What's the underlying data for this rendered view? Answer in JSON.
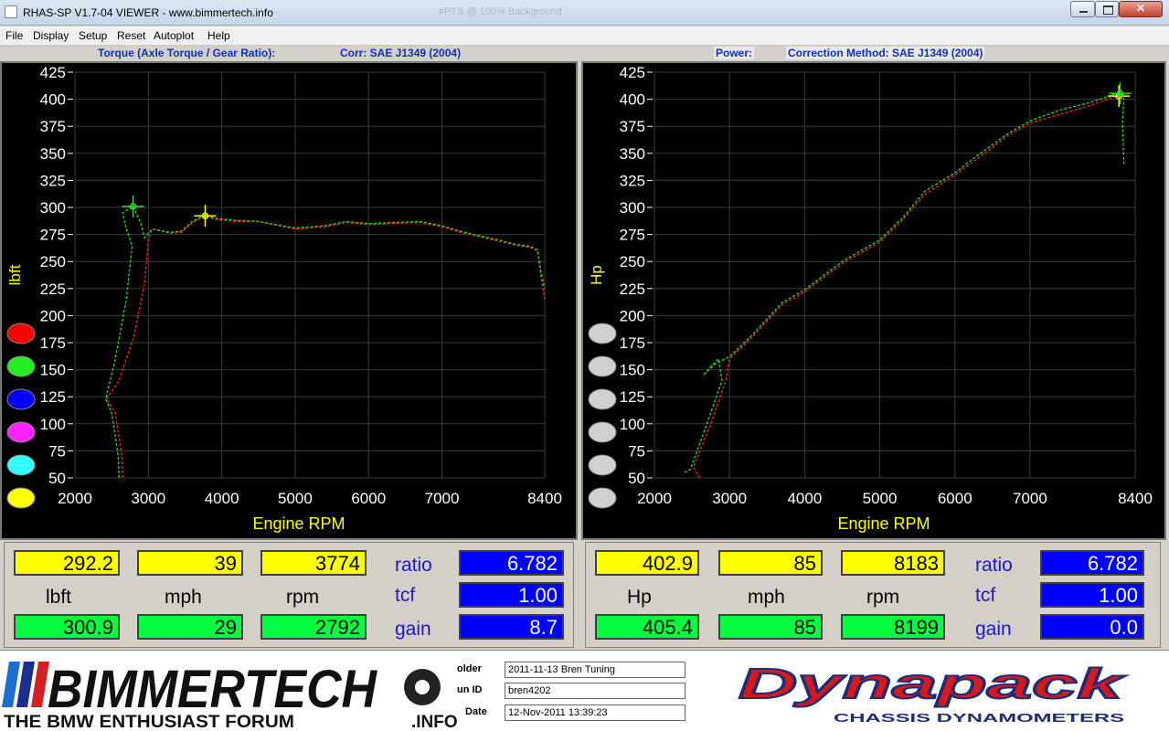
{
  "window": {
    "title": "RHAS-SP V1.7-04  VIEWER - www.bimmertech.info",
    "ghost_title": "#PTS @ 100% Background"
  },
  "menu": [
    "File",
    "Display",
    "Setup",
    "Reset",
    "Autoplot",
    "Help"
  ],
  "left_chart": {
    "header_title": "Torque (Axle Torque / Gear Ratio):",
    "header_corr": "Corr: SAE J1349 (2004)"
  },
  "right_chart": {
    "header_title": "Power:",
    "header_corr": "Correction Method: SAE J1349 (2004)"
  },
  "chart_data": [
    {
      "type": "line",
      "title": "Torque (Axle Torque / Gear Ratio):",
      "xlabel": "Engine RPM",
      "ylabel": "lbft",
      "xlim": [
        2000,
        8400
      ],
      "ylim": [
        50,
        425
      ],
      "x_ticks": [
        "2000",
        "3000",
        "4000",
        "5000",
        "6000",
        "7000",
        "8400"
      ],
      "x_tick_values": [
        2000,
        3000,
        4000,
        5000,
        6000,
        7000,
        8400
      ],
      "y_ticks": [
        50,
        75,
        100,
        125,
        150,
        175,
        200,
        225,
        250,
        275,
        300,
        325,
        350,
        375,
        400,
        425
      ],
      "grid": true,
      "series": [
        {
          "color": "#ff2020",
          "x": [
            2650,
            2640,
            2550,
            2430,
            2600,
            2800,
            2950,
            3000,
            3050,
            3300,
            3450,
            3600,
            3774,
            3900,
            4200,
            4500,
            5000,
            5400,
            5700,
            6000,
            6300,
            6700,
            7000,
            7300,
            7700,
            8000,
            8200,
            8300,
            8350,
            8400
          ],
          "y": [
            50,
            70,
            110,
            123,
            140,
            180,
            230,
            270,
            280,
            276,
            277,
            286,
            292,
            289,
            287,
            287,
            280,
            282,
            286,
            284,
            285,
            286,
            282,
            276,
            270,
            265,
            263,
            260,
            235,
            215
          ]
        },
        {
          "color": "#20e020",
          "x": [
            2600,
            2590,
            2500,
            2420,
            2550,
            2700,
            2780,
            2700,
            2650,
            2792,
            2900,
            2950,
            3050,
            3300,
            3450,
            3600,
            3774,
            3900,
            4200,
            4500,
            5000,
            5400,
            5700,
            6000,
            6300,
            6700,
            7000,
            7300,
            7700,
            8000,
            8200,
            8300,
            8350,
            8400
          ],
          "y": [
            50,
            70,
            110,
            123,
            160,
            215,
            265,
            280,
            295,
            301,
            285,
            272,
            280,
            277,
            278,
            287,
            293,
            290,
            288,
            287,
            281,
            283,
            287,
            285,
            286,
            287,
            283,
            277,
            271,
            266,
            264,
            261,
            240,
            225
          ]
        }
      ],
      "markers": [
        {
          "color": "#20e020",
          "x": 2792,
          "y": 300.9
        },
        {
          "color": "#ffff00",
          "x": 3774,
          "y": 292.2
        }
      ]
    },
    {
      "type": "line",
      "title": "Power:",
      "xlabel": "Engine RPM",
      "ylabel": "Hp",
      "xlim": [
        2000,
        8400
      ],
      "ylim": [
        50,
        425
      ],
      "x_ticks": [
        "2000",
        "3000",
        "4000",
        "5000",
        "6000",
        "7000",
        "8400"
      ],
      "x_tick_values": [
        2000,
        3000,
        4000,
        5000,
        6000,
        7000,
        8400
      ],
      "y_ticks": [
        50,
        75,
        100,
        125,
        150,
        175,
        200,
        225,
        250,
        275,
        300,
        325,
        350,
        375,
        400,
        425
      ],
      "grid": true,
      "series": [
        {
          "color": "#ff2020",
          "x": [
            2600,
            2520,
            2750,
            2950,
            3000,
            3300,
            3700,
            4000,
            4500,
            5000,
            5300,
            5600,
            6000,
            6300,
            6700,
            7000,
            7400,
            7800,
            8100,
            8183,
            8250
          ],
          "y": [
            50,
            60,
            100,
            140,
            160,
            180,
            210,
            222,
            248,
            268,
            288,
            312,
            330,
            345,
            366,
            378,
            386,
            394,
            402,
            403,
            403
          ]
        },
        {
          "color": "#20e020",
          "x": [
            2400,
            2480,
            2700,
            2900,
            2850,
            2650,
            2800,
            3000,
            3300,
            3700,
            4000,
            4500,
            5000,
            5300,
            5600,
            6000,
            6300,
            6700,
            7000,
            7400,
            7800,
            8100,
            8199,
            8250,
            8230,
            8250
          ],
          "y": [
            55,
            58,
            100,
            140,
            160,
            145,
            155,
            162,
            182,
            212,
            224,
            250,
            270,
            290,
            315,
            332,
            348,
            368,
            380,
            390,
            397,
            404,
            406,
            400,
            380,
            340
          ]
        }
      ],
      "markers": [
        {
          "color": "#ffff00",
          "x": 8183,
          "y": 402.9
        },
        {
          "color": "#20e020",
          "x": 8199,
          "y": 405.4
        }
      ]
    }
  ],
  "swatches_left": [
    "#ff0000",
    "#22ee22",
    "#0000ff",
    "#ff22ff",
    "#33ffff",
    "#ffff00"
  ],
  "swatches_right": [
    "#d0d0d0",
    "#d0d0d0",
    "#d0d0d0",
    "#d0d0d0",
    "#d0d0d0",
    "#d0d0d0"
  ],
  "readouts_left": {
    "cur_value": "292.2",
    "cur_mph": "39",
    "cur_rpm": "3774",
    "unit": "lbft",
    "mph_label": "mph",
    "rpm_label": "rpm",
    "peak_value": "300.9",
    "peak_mph": "29",
    "peak_rpm": "2792",
    "ratio_label": "ratio",
    "ratio": "6.782",
    "tcf_label": "tcf",
    "tcf": "1.00",
    "gain_label": "gain",
    "gain": "8.7"
  },
  "readouts_right": {
    "cur_value": "402.9",
    "cur_mph": "85",
    "cur_rpm": "8183",
    "unit": "Hp",
    "mph_label": "mph",
    "rpm_label": "rpm",
    "peak_value": "405.4",
    "peak_mph": "85",
    "peak_rpm": "8199",
    "ratio_label": "ratio",
    "ratio": "6.782",
    "tcf_label": "tcf",
    "tcf": "1.00",
    "gain_label": "gain",
    "gain": "0.0"
  },
  "footer": {
    "bimmertech": "BIMMERTECH",
    "bimmertech_sub": "THE BMW ENTHUSIAST FORUM",
    "bimmertech_info": ".INFO",
    "folder_label": "older",
    "folder_value": "2011-11-13 Bren Tuning",
    "runid_label": "un ID",
    "runid_value": "bren4202",
    "date_label": "Date",
    "date_value": "12-Nov-2011  13:39:23",
    "dynapack": "Dynapack",
    "dynapack_sub": "CHASSIS   DYNAMOMETERS"
  },
  "colors": {
    "axis_label": "#ffff00",
    "tick_text": "#ffffff",
    "grid": "#3c3c3c",
    "header_blue": "#1030b8",
    "readout_yellow": "#ffff00",
    "readout_green": "#00ff40",
    "readout_blue": "#0000ff"
  }
}
